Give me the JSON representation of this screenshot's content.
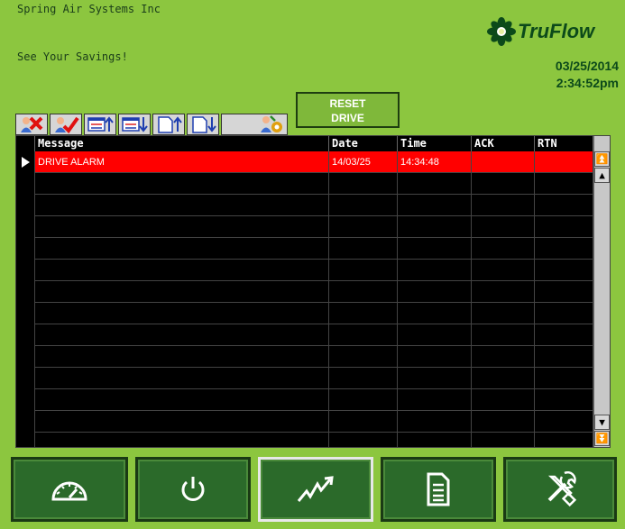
{
  "header": {
    "company": "Spring Air Systems Inc",
    "tagline": "See Your Savings!",
    "logo_text": "TruFlow",
    "date": "03/25/2014",
    "time": "2:34:52pm"
  },
  "toolbar": {
    "icons": [
      "ack-alarm-icon",
      "ack-all-alarms-icon",
      "sort-up-icon",
      "sort-down-icon",
      "page-up-icon",
      "page-down-icon",
      "alarm-settings-icon"
    ],
    "reset_line1": "RESET",
    "reset_line2": "DRIVE"
  },
  "table": {
    "columns": [
      "Message",
      "Date",
      "Time",
      "ACK",
      "RTN"
    ],
    "rows": [
      {
        "message": "DRIVE ALARM",
        "date": "14/03/25",
        "time": "14:34:48",
        "ack": "",
        "rtn": "",
        "selected": true
      },
      {
        "message": "",
        "date": "",
        "time": "",
        "ack": "",
        "rtn": "",
        "selected": false
      },
      {
        "message": "",
        "date": "",
        "time": "",
        "ack": "",
        "rtn": "",
        "selected": false
      },
      {
        "message": "",
        "date": "",
        "time": "",
        "ack": "",
        "rtn": "",
        "selected": false
      },
      {
        "message": "",
        "date": "",
        "time": "",
        "ack": "",
        "rtn": "",
        "selected": false
      },
      {
        "message": "",
        "date": "",
        "time": "",
        "ack": "",
        "rtn": "",
        "selected": false
      },
      {
        "message": "",
        "date": "",
        "time": "",
        "ack": "",
        "rtn": "",
        "selected": false
      },
      {
        "message": "",
        "date": "",
        "time": "",
        "ack": "",
        "rtn": "",
        "selected": false
      },
      {
        "message": "",
        "date": "",
        "time": "",
        "ack": "",
        "rtn": "",
        "selected": false
      },
      {
        "message": "",
        "date": "",
        "time": "",
        "ack": "",
        "rtn": "",
        "selected": false
      },
      {
        "message": "",
        "date": "",
        "time": "",
        "ack": "",
        "rtn": "",
        "selected": false
      },
      {
        "message": "",
        "date": "",
        "time": "",
        "ack": "",
        "rtn": "",
        "selected": false
      },
      {
        "message": "",
        "date": "",
        "time": "",
        "ack": "",
        "rtn": "",
        "selected": false
      },
      {
        "message": "",
        "date": "",
        "time": "",
        "ack": "",
        "rtn": "",
        "selected": false
      }
    ]
  },
  "nav": {
    "buttons": [
      "gauge-icon",
      "power-icon",
      "trend-icon",
      "document-icon",
      "tools-icon"
    ],
    "active": "trend-icon"
  },
  "colors": {
    "background": "#8cc63f",
    "selected_row": "#ff0000",
    "nav_button": "#2b6a2a"
  }
}
